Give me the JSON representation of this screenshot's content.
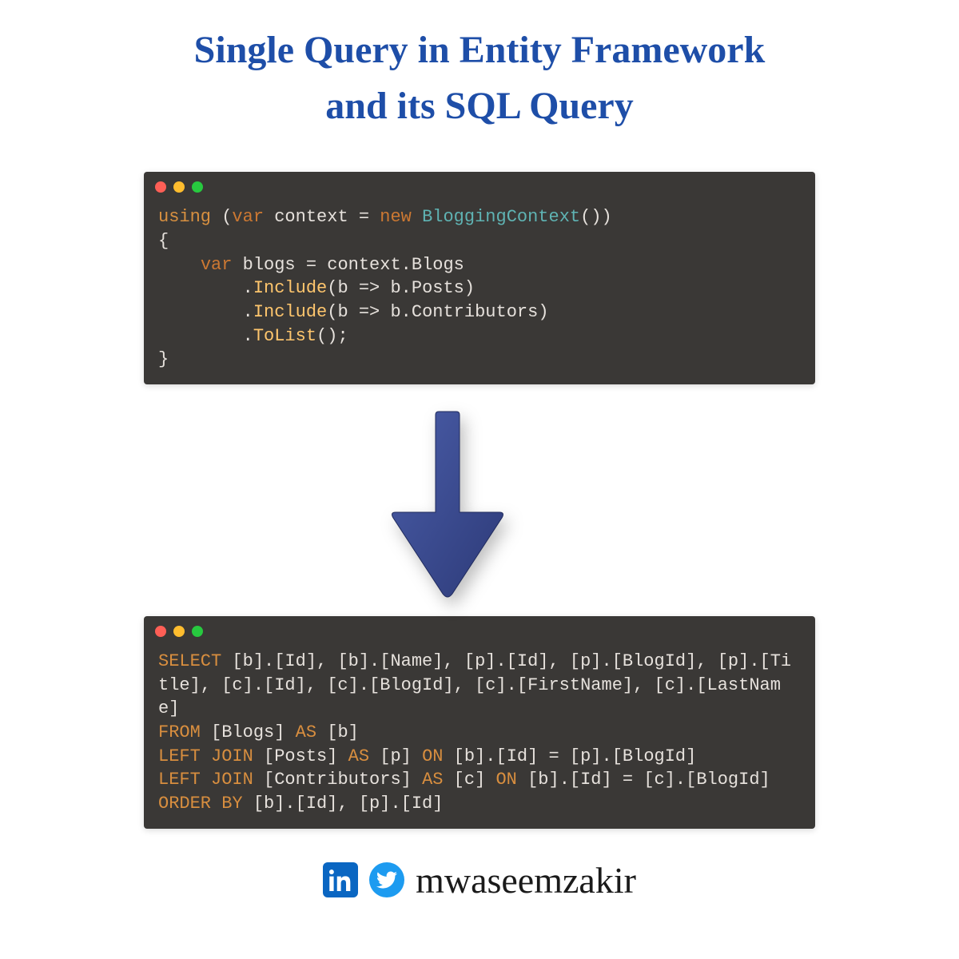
{
  "title_line1": "Single Query in Entity Framework",
  "title_line2": "and its SQL Query",
  "csharp": {
    "using": "using",
    "var1": "var",
    "context": "context",
    "new": "new",
    "BloggingContext": "BloggingContext",
    "openParen": "(",
    "closeParen": ")",
    "openBrace": "{",
    "closeBrace": "}",
    "var2": "var",
    "blogs": "blogs",
    "eq": "=",
    "ctx2": "context",
    "dot": ".",
    "Blogs": "Blogs",
    "Include1": "Include",
    "lambda_b": "b",
    "arrow": "=>",
    "Posts": "Posts",
    "Include2": "Include",
    "Contributors": "Contributors",
    "ToList": "ToList",
    "semicolon": ";",
    "emptyParens": "()"
  },
  "sql": {
    "SELECT": "SELECT",
    "select_cols": " [b].[Id], [b].[Name], [p].[Id], [p].[BlogId], [p].[Title], [c].[Id], [c].[BlogId], [c].[FirstName], [c].[LastName]",
    "FROM": "FROM",
    "from_tbl": " [Blogs] ",
    "AS1": "AS",
    "as_b": " [b]",
    "LEFT1": "LEFT",
    "JOIN1": "JOIN",
    "posts_tbl": " [Posts] ",
    "AS2": "AS",
    "as_p": " [p] ",
    "ON1": "ON",
    "on_p": " [b].[Id] = [p].[BlogId]",
    "LEFT2": "LEFT",
    "JOIN2": "JOIN",
    "contrib_tbl": " [Contributors] ",
    "AS3": "AS",
    "as_c": " [c] ",
    "ON2": "ON",
    "on_c": " [b].[Id] = [c].[BlogId]",
    "ORDER": "ORDER",
    "BY": "BY",
    "order_cols": " [b].[Id], [p].[Id]"
  },
  "footer": {
    "handle": "mwaseemzakir"
  },
  "icons": {
    "linkedin": "linkedin-icon",
    "twitter": "twitter-icon",
    "arrow": "down-arrow-icon",
    "window_red": "window-close-dot",
    "window_yellow": "window-min-dot",
    "window_green": "window-max-dot"
  }
}
